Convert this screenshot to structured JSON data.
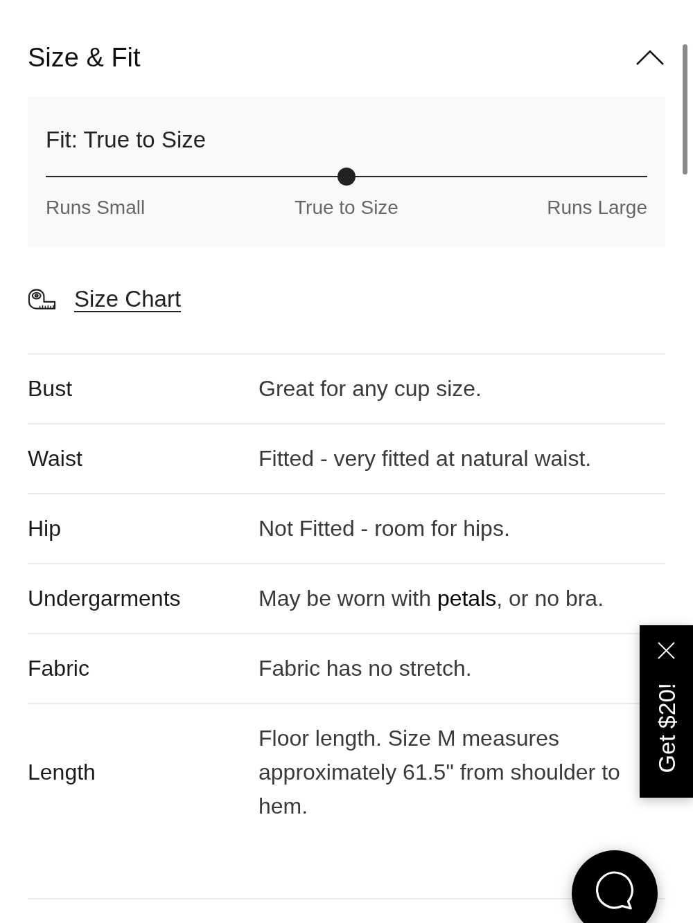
{
  "section": {
    "title": "Size & Fit",
    "expanded": true
  },
  "fit": {
    "title": "Fit: True to Size",
    "level": 0.5,
    "scale_labels": [
      "Runs Small",
      "True to Size",
      "Runs Large"
    ]
  },
  "size_chart_link": {
    "label": "Size Chart"
  },
  "details": [
    {
      "label": "Bust",
      "value": "Great for any cup size."
    },
    {
      "label": "Waist",
      "value": "Fitted - very fitted at natural waist."
    },
    {
      "label": "Hip",
      "value": "Not Fitted - room for hips."
    },
    {
      "label": "Undergarments",
      "value": "May be worn with **petals**, or no bra."
    },
    {
      "label": "Fabric",
      "value": "Fabric has no stretch."
    },
    {
      "label": "Length",
      "value": "Floor length. Size M measures approximately 61.5\" from shoulder to hem."
    }
  ],
  "promo_tab": {
    "label": "Get $20!"
  }
}
